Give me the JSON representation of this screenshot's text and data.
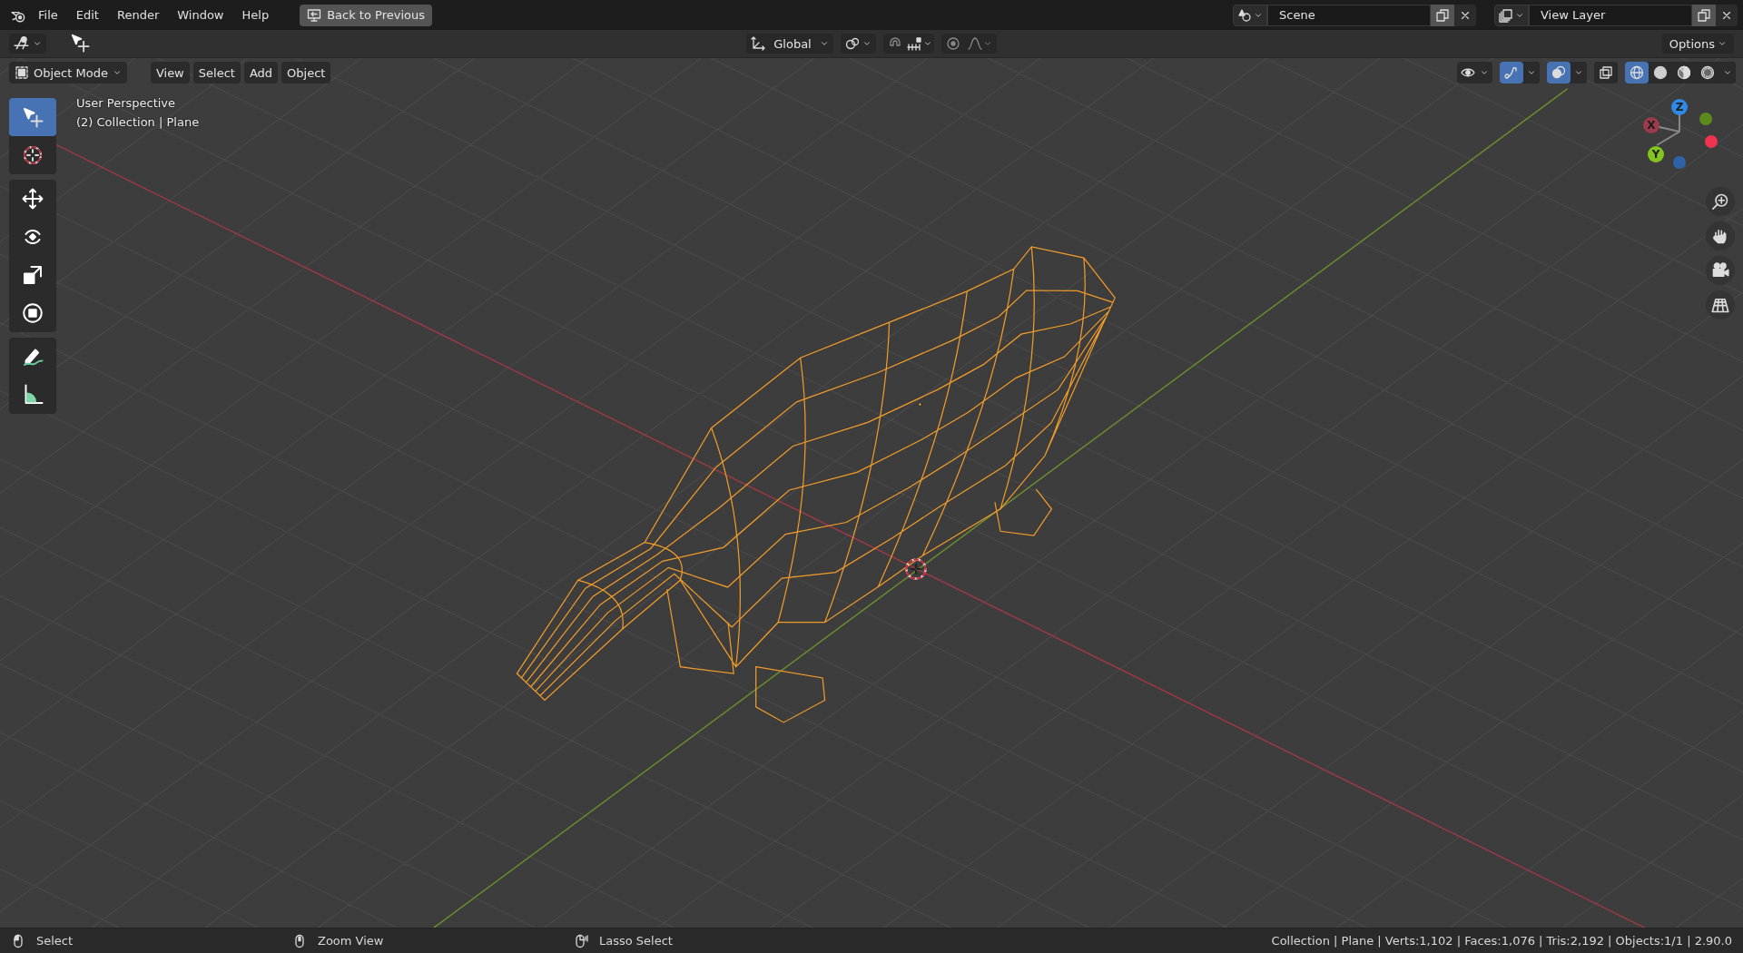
{
  "menu": [
    "File",
    "Edit",
    "Render",
    "Window",
    "Help"
  ],
  "back_button": "Back to Previous",
  "scene": {
    "name": "Scene"
  },
  "view_layer": {
    "name": "View Layer"
  },
  "tool_header": {
    "orientation": "Global",
    "snap": {
      "on": false
    },
    "proportional": {
      "on": false
    },
    "options": "Options"
  },
  "viewport_header": {
    "mode": "Object Mode",
    "menus": [
      "View",
      "Select",
      "Add",
      "Object"
    ],
    "toggles": [
      {
        "kind": "gizmo",
        "selected": true
      },
      {
        "kind": "overlays",
        "selected": true
      },
      {
        "kind": "xray",
        "selected": false
      }
    ],
    "shading": [
      {
        "kind": "wireframe",
        "selected": true
      },
      {
        "kind": "solid",
        "selected": false
      },
      {
        "kind": "material",
        "selected": false
      },
      {
        "kind": "rendered",
        "selected": false
      }
    ]
  },
  "viewport": {
    "info": [
      "User Perspective",
      "(2) Collection | Plane"
    ],
    "gizmo_axes": [
      {
        "label": "X",
        "color": "#9c3b4b"
      },
      {
        "label": "Y",
        "color": "#85c41c"
      },
      {
        "label": "Z",
        "color": "#2e8ae6"
      }
    ]
  },
  "toolbar": [
    [
      {
        "kind": "select_box",
        "selected": true
      },
      {
        "kind": "cursor",
        "selected": false
      }
    ],
    [
      {
        "kind": "move",
        "selected": false
      },
      {
        "kind": "rotate",
        "selected": false
      },
      {
        "kind": "scale",
        "selected": false
      },
      {
        "kind": "transform",
        "selected": false
      }
    ],
    [
      {
        "kind": "annotate",
        "selected": false
      },
      {
        "kind": "measure",
        "selected": false
      }
    ]
  ],
  "status_bar": {
    "hints": [
      {
        "kind": "left",
        "label": "Select"
      },
      {
        "kind": "middle",
        "label": "Zoom View"
      },
      {
        "kind": "right",
        "label": "Lasso Select"
      }
    ],
    "stats": "Collection | Plane | Verts:1,102 | Faces:1,076 | Tris:2,192 | Objects:1/1 | 2.90.0"
  }
}
